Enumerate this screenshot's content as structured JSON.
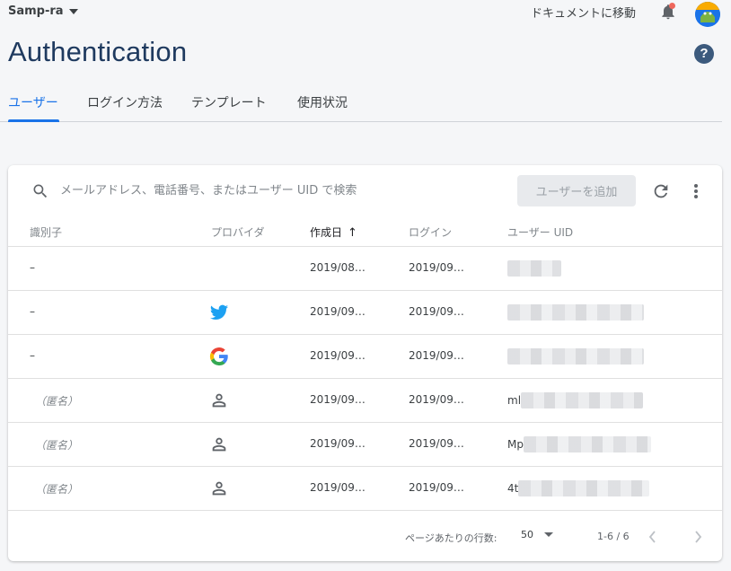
{
  "header": {
    "project_name": "Samp-ra",
    "docs_link": "ドキュメントに移動",
    "page_title": "Authentication"
  },
  "tabs": [
    {
      "label": "ユーザー",
      "active": true
    },
    {
      "label": "ログイン方法",
      "active": false
    },
    {
      "label": "テンプレート",
      "active": false
    },
    {
      "label": "使用状況",
      "active": false
    }
  ],
  "toolbar": {
    "search_placeholder": "メールアドレス、電話番号、またはユーザー UID で検索",
    "add_user_label": "ユーザーを追加"
  },
  "table": {
    "columns": [
      "識別子",
      "プロバイダ",
      "作成日",
      "ログイン",
      "ユーザー UID"
    ],
    "sorted_column": "作成日",
    "rows": [
      {
        "identifier": "–",
        "provider": "",
        "created": "2019/08…",
        "signed_in": "2019/09…",
        "uid_prefix": ""
      },
      {
        "identifier": "–",
        "provider": "twitter-icon",
        "created": "2019/09…",
        "signed_in": "2019/09…",
        "uid_prefix": ""
      },
      {
        "identifier": "–",
        "provider": "google-icon",
        "created": "2019/09…",
        "signed_in": "2019/09…",
        "uid_prefix": ""
      },
      {
        "identifier": "（匿名）",
        "provider": "person-icon",
        "created": "2019/09…",
        "signed_in": "2019/09…",
        "uid_prefix": "ml"
      },
      {
        "identifier": "（匿名）",
        "provider": "person-icon",
        "created": "2019/09…",
        "signed_in": "2019/09…",
        "uid_prefix": "Mp"
      },
      {
        "identifier": "（匿名）",
        "provider": "person-icon",
        "created": "2019/09…",
        "signed_in": "2019/09…",
        "uid_prefix": "4t"
      }
    ]
  },
  "footer": {
    "rows_per_page_label": "ページあたりの行数:",
    "rows_per_page": "50",
    "range": "1-6 / 6"
  },
  "colors": {
    "accent": "#1a73e8",
    "title": "#1f3a5f",
    "notification": "#ee675c",
    "twitter": "#1da1f2"
  }
}
